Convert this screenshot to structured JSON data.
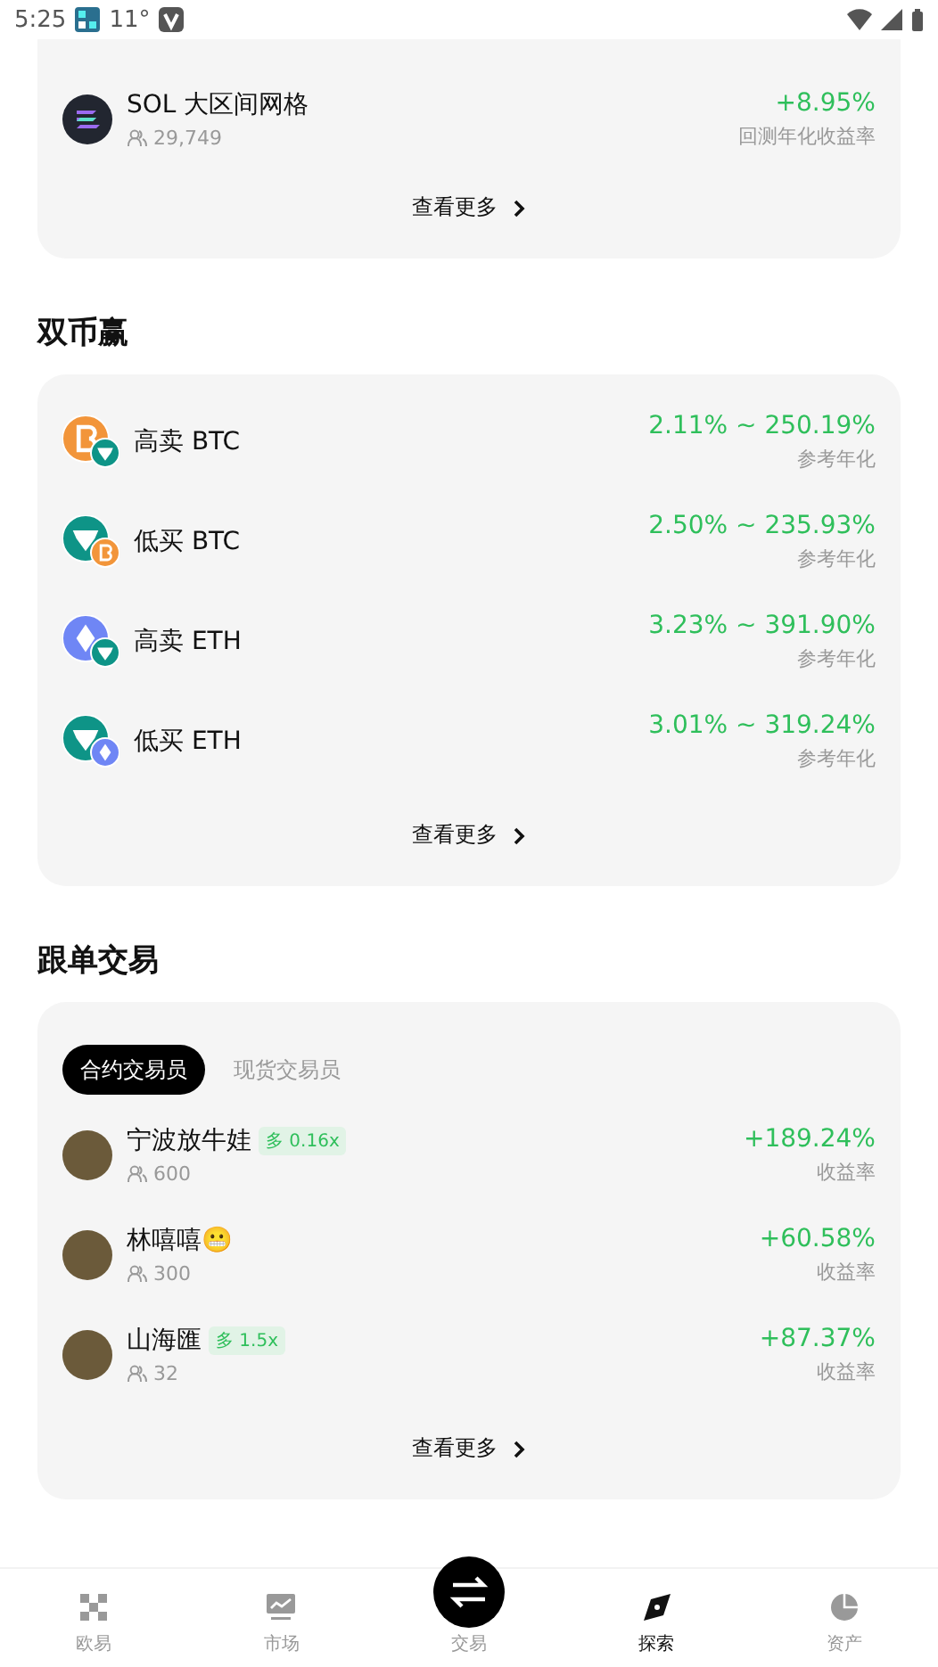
{
  "status_bar": {
    "time": "5:25",
    "temperature": "11°"
  },
  "grid_card": {
    "items": [
      {
        "name": "SOL 大区间网格",
        "followers": "29,749",
        "value": "+8.95%",
        "caption": "回测年化收益率"
      }
    ],
    "more": "查看更多"
  },
  "dual_invest": {
    "title": "双币赢",
    "items": [
      {
        "kind": "btc-usdt",
        "name": "高卖 BTC",
        "value": "2.11% ~ 250.19%",
        "caption": "参考年化"
      },
      {
        "kind": "usdt-btc",
        "name": "低买 BTC",
        "value": "2.50% ~ 235.93%",
        "caption": "参考年化"
      },
      {
        "kind": "eth-usdt",
        "name": "高卖 ETH",
        "value": "3.23% ~ 391.90%",
        "caption": "参考年化"
      },
      {
        "kind": "usdt-eth",
        "name": "低买 ETH",
        "value": "3.01% ~ 319.24%",
        "caption": "参考年化"
      }
    ],
    "more": "查看更多"
  },
  "copy_trading": {
    "title": "跟单交易",
    "tabs": [
      {
        "label": "合约交易员",
        "selected": true
      },
      {
        "label": "现货交易员",
        "selected": false
      }
    ],
    "traders": [
      {
        "name": "宁波放牛娃",
        "badge": "多 0.16x",
        "followers": "600",
        "value": "+189.24%",
        "caption": "收益率"
      },
      {
        "name": "林嘻嘻😬",
        "followers": "300",
        "value": "+60.58%",
        "caption": "收益率"
      },
      {
        "name": "山海匯",
        "badge": "多 1.5x",
        "followers": "32",
        "value": "+87.37%",
        "caption": "收益率"
      }
    ],
    "more": "查看更多"
  },
  "bottom_nav": [
    {
      "kind": "home",
      "label": "欧易",
      "selected": false
    },
    {
      "kind": "market",
      "label": "市场",
      "selected": false
    },
    {
      "kind": "trade",
      "label": "交易",
      "selected": false
    },
    {
      "kind": "explore",
      "label": "探索",
      "selected": true
    },
    {
      "kind": "assets",
      "label": "资产",
      "selected": false
    }
  ]
}
